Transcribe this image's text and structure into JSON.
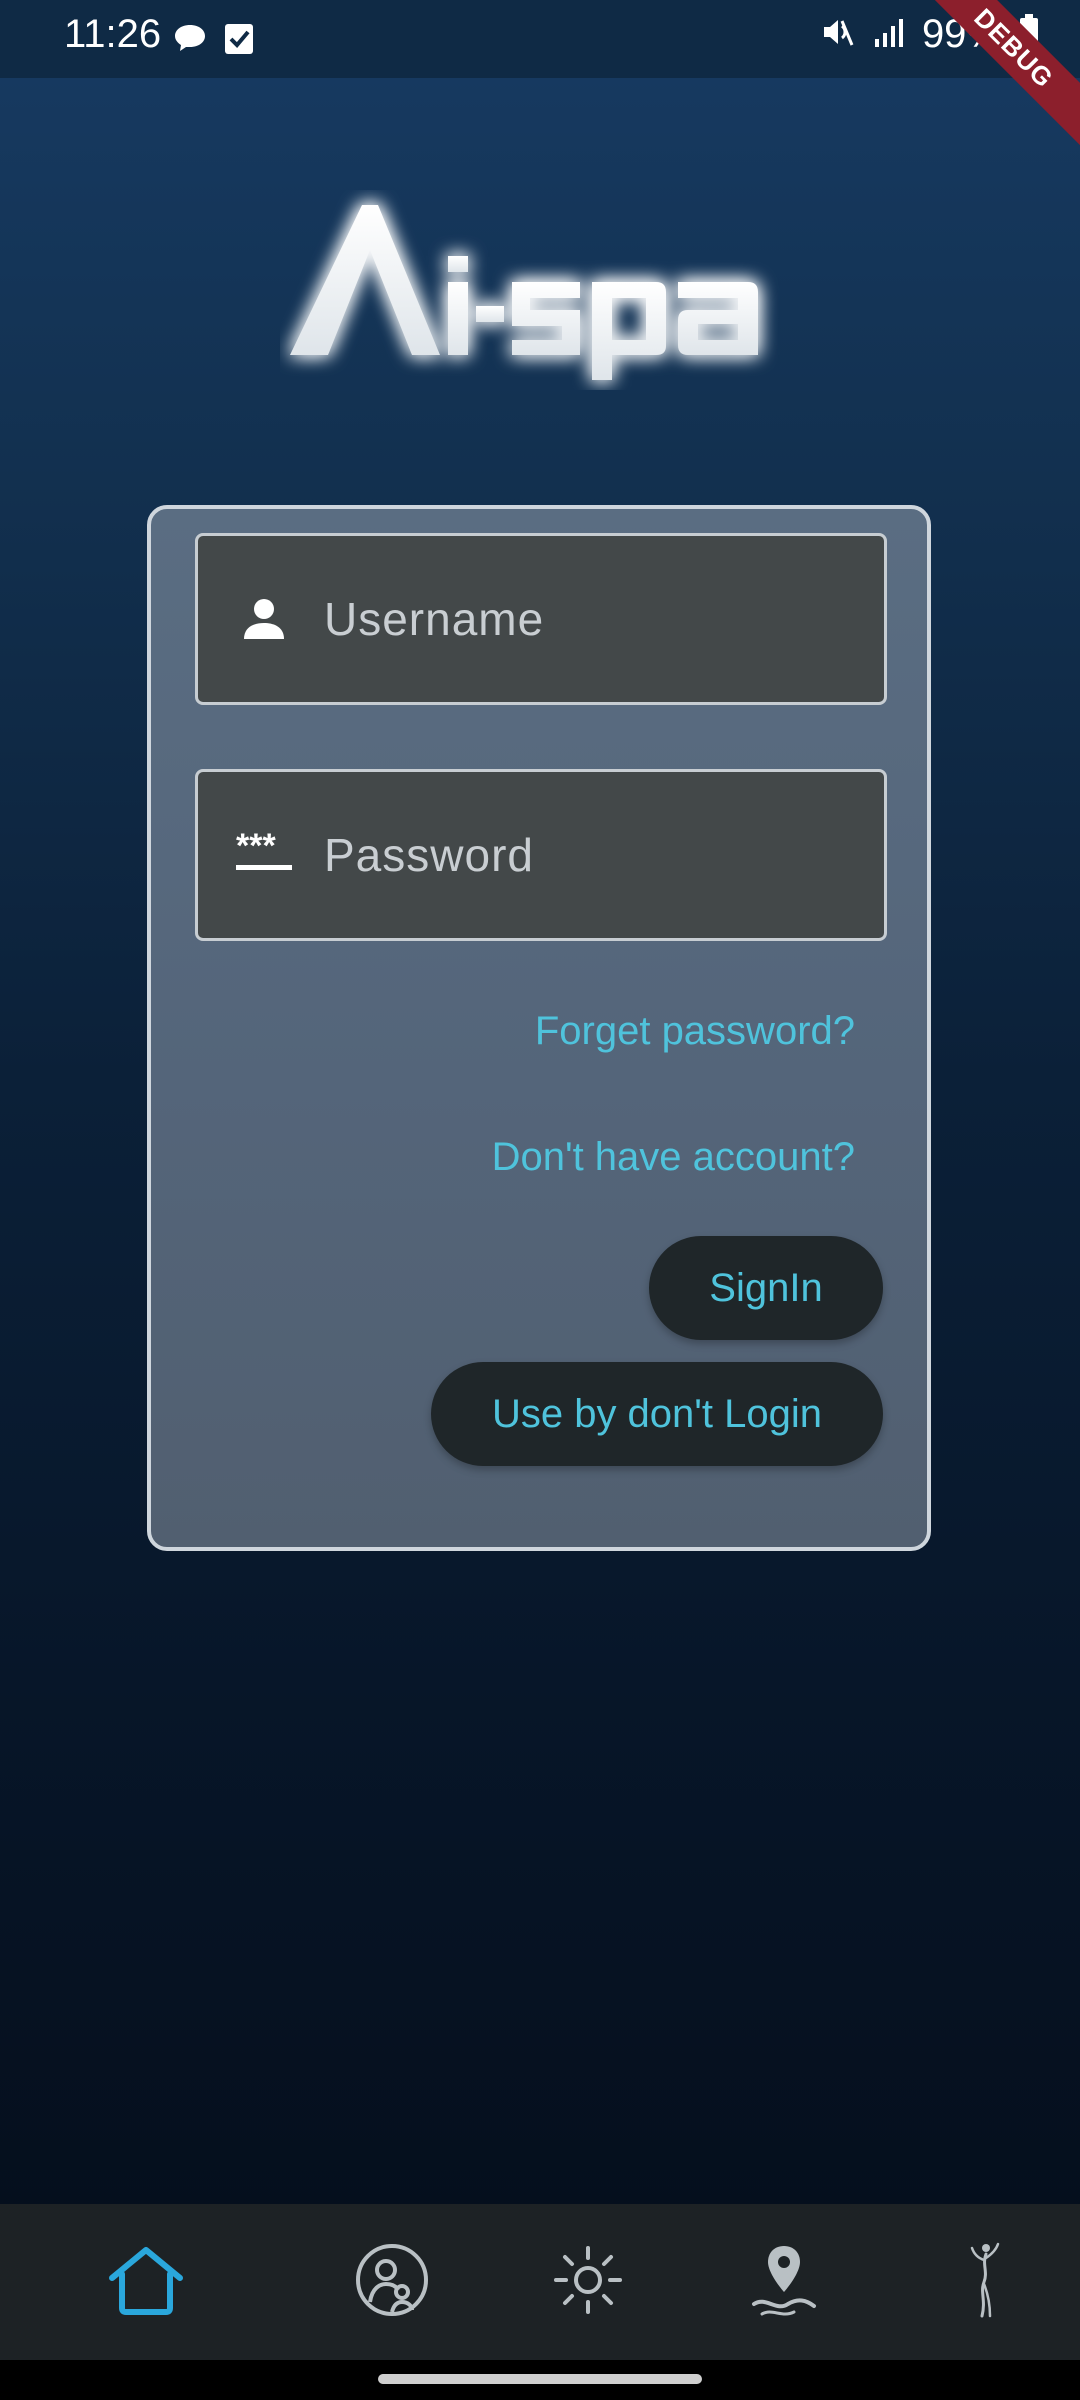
{
  "status_bar": {
    "time": "11:26",
    "battery": "99%"
  },
  "debug_banner": "DEBUG",
  "logo": {
    "text": "Ai-spa"
  },
  "login": {
    "username_placeholder": "Username",
    "password_placeholder": "Password",
    "forgot_password": "Forget password?",
    "no_account": "Don't have account?",
    "signin_label": "SignIn",
    "guest_label": "Use by don't Login"
  },
  "bottom_nav": {
    "items": [
      {
        "icon": "home-icon",
        "active": true
      },
      {
        "icon": "profile-icon",
        "active": false
      },
      {
        "icon": "sun-icon",
        "active": false
      },
      {
        "icon": "location-pin-icon",
        "active": false
      },
      {
        "icon": "body-figure-icon",
        "active": false
      }
    ]
  },
  "colors": {
    "accent": "#4fc3dc",
    "nav_active": "#2aa7dc",
    "nav_inactive": "#b9c0c4",
    "card_border": "#cfd6dd",
    "button_bg": "#1f2629"
  }
}
